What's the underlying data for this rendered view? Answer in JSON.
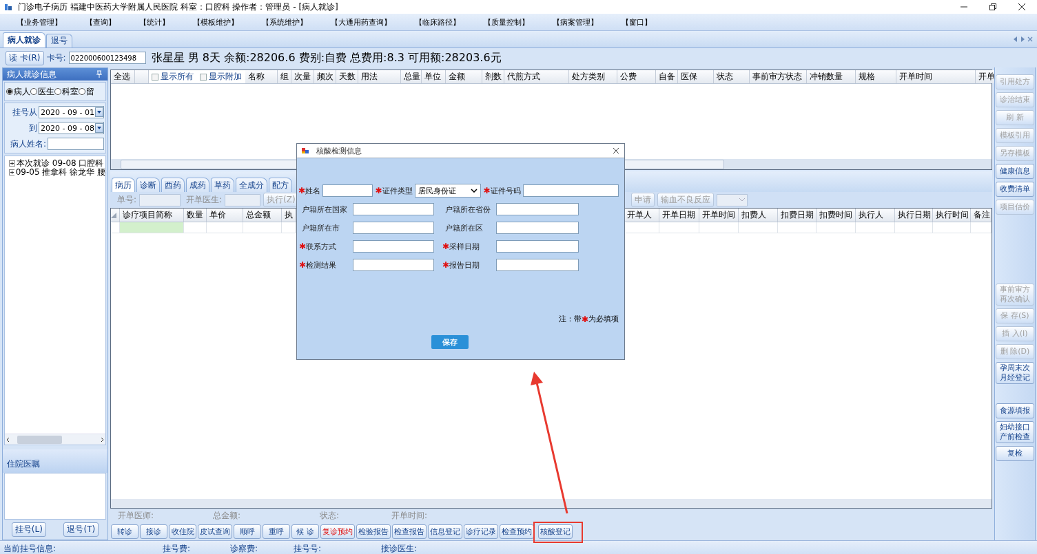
{
  "window": {
    "title": "门诊电子病历  福建中医药大学附属人民医院  科室：口腔科  操作者：管理员 - [病人就诊]"
  },
  "menu": [
    "【业务管理】",
    "【查询】",
    "【统计】",
    "【模板维护】",
    "【系统维护】",
    "【大通用药查询】",
    "【临床路径】",
    "【质量控制】",
    "【病案管理】",
    "【窗口】"
  ],
  "tabs": [
    {
      "label": "病人就诊",
      "selected": true
    },
    {
      "label": "退号",
      "selected": false
    }
  ],
  "patient_bar": {
    "read_card_button": "读 卡(R)",
    "card_label": "卡号:",
    "card_value": "022000600123498",
    "summary": "张星星 男 8天 余额:28206.6 费别:自费 总费用:8.3 可用额:28203.6元"
  },
  "left_panel": {
    "title": "病人就诊信息",
    "radios": [
      {
        "label": "病人",
        "selected": true
      },
      {
        "label": "医生",
        "selected": false
      },
      {
        "label": "科室",
        "selected": false
      },
      {
        "label": "留",
        "selected": false
      }
    ],
    "date_from": {
      "label": "挂号从",
      "value": "2020 - 09 - 01"
    },
    "date_to": {
      "label": "到",
      "value": "2020 - 09 - 08"
    },
    "name_field": {
      "label": "病人姓名:"
    },
    "tree": [
      {
        "label": "本次就诊  09-08  口腔科",
        "expanded": false
      },
      {
        "label": "09-05  推拿科  徐龙华  腰",
        "expanded": false
      }
    ],
    "section_title": "住院医嘱",
    "buttons": [
      "挂号(L)",
      "退号(T)"
    ]
  },
  "top_table": {
    "columns": [
      {
        "kind": "text",
        "label": "全选"
      },
      {
        "kind": "blank"
      },
      {
        "kind": "checkbox",
        "label": "显示所有",
        "checked": false
      },
      {
        "kind": "checkbox",
        "label": "显示附加",
        "checked": false
      },
      {
        "kind": "text",
        "label": "名称"
      },
      {
        "kind": "text",
        "label": "组"
      },
      {
        "kind": "text",
        "label": "次量"
      },
      {
        "kind": "text",
        "label": "频次"
      },
      {
        "kind": "text",
        "label": "天数"
      },
      {
        "kind": "text",
        "label": "用法"
      },
      {
        "kind": "text",
        "label": "总量"
      },
      {
        "kind": "text",
        "label": "单位"
      },
      {
        "kind": "text",
        "label": "金额"
      },
      {
        "kind": "text",
        "label": "剂数"
      },
      {
        "kind": "text",
        "label": "代煎方式"
      },
      {
        "kind": "text",
        "label": "处方类别"
      },
      {
        "kind": "text",
        "label": "公费"
      },
      {
        "kind": "text",
        "label": "自备"
      },
      {
        "kind": "text",
        "label": "医保"
      },
      {
        "kind": "text",
        "label": "状态"
      },
      {
        "kind": "text",
        "label": "事前审方状态"
      },
      {
        "kind": "text",
        "label": "冲销数量"
      },
      {
        "kind": "text",
        "label": "规格"
      },
      {
        "kind": "text",
        "label": "开单时间"
      },
      {
        "kind": "text",
        "label": "开单"
      }
    ]
  },
  "middle_tabs": [
    {
      "label": "病历",
      "selected": true
    },
    {
      "label": "诊断",
      "selected": false
    },
    {
      "label": "西药",
      "selected": false
    },
    {
      "label": "成药",
      "selected": false
    },
    {
      "label": "草药",
      "selected": false
    },
    {
      "label": "全成分",
      "selected": false
    },
    {
      "label": "配方",
      "selected": false
    }
  ],
  "order_toolbar": {
    "order_no_label": "单号:",
    "doctor_label": "开单医生:",
    "execute_button": "执行(Z)",
    "apply_button": "申请",
    "reaction_button": "输血不良反应"
  },
  "lower_table": {
    "columns": [
      {
        "kind": "selector"
      },
      {
        "kind": "text",
        "label": "诊疗项目简称"
      },
      {
        "kind": "text",
        "label": "数量"
      },
      {
        "kind": "text",
        "label": "单价"
      },
      {
        "kind": "text",
        "label": "总金额"
      },
      {
        "kind": "text",
        "label": "执"
      },
      {
        "kind": "hidden"
      },
      {
        "kind": "text",
        "label": "开单人"
      },
      {
        "kind": "text",
        "label": "开单日期"
      },
      {
        "kind": "text",
        "label": "开单时间"
      },
      {
        "kind": "text",
        "label": "扣费人"
      },
      {
        "kind": "text",
        "label": "扣费日期"
      },
      {
        "kind": "text",
        "label": "扣费时间"
      },
      {
        "kind": "text",
        "label": "执行人"
      },
      {
        "kind": "text",
        "label": "执行日期"
      },
      {
        "kind": "text",
        "label": "执行时间"
      },
      {
        "kind": "text",
        "label": "备注"
      }
    ],
    "rows": [
      {
        "selected": true
      }
    ]
  },
  "footer_info": [
    "开单医师:",
    "总金额:",
    "状态:",
    "开单时间:"
  ],
  "action_buttons": [
    {
      "label": "转诊",
      "kind": "normal"
    },
    {
      "label": "接诊",
      "kind": "normal"
    },
    {
      "label": "收住院",
      "kind": "normal"
    },
    {
      "label": "皮试查询",
      "kind": "normal"
    },
    {
      "label": "顺呼",
      "kind": "normal"
    },
    {
      "label": "重呼",
      "kind": "normal"
    },
    {
      "label": "候 诊",
      "kind": "normal"
    },
    {
      "label": "复诊预约",
      "kind": "alert"
    },
    {
      "label": "检验报告",
      "kind": "normal"
    },
    {
      "label": "检查报告",
      "kind": "normal"
    },
    {
      "label": "信息登记",
      "kind": "normal"
    },
    {
      "label": "诊疗记录",
      "kind": "normal"
    },
    {
      "label": "检查预约",
      "kind": "normal"
    },
    {
      "label": "核酸登记",
      "kind": "normal"
    }
  ],
  "right_panel": {
    "groups": [
      {
        "buttons": [
          {
            "label": "引用处方",
            "disabled": true
          },
          {
            "label": "诊治结束",
            "disabled": true
          },
          {
            "label": "刷 新",
            "disabled": true
          },
          {
            "label": "模板引用",
            "disabled": true
          },
          {
            "label": "另存模板",
            "disabled": true
          },
          {
            "label": "健康信息",
            "disabled": false
          },
          {
            "label": "收费清单",
            "disabled": false
          },
          {
            "label": "项目估价",
            "disabled": true
          }
        ]
      },
      {
        "buttons": [
          {
            "label": "事前审方再次确认",
            "disabled": true
          },
          {
            "label": "保 存(S)",
            "disabled": true
          },
          {
            "label": "插 入(I)",
            "disabled": true
          },
          {
            "label": "删 除(D)",
            "disabled": true
          },
          {
            "label": "孕周末次月经登记",
            "disabled": false
          }
        ]
      },
      {
        "buttons": [
          {
            "label": "食源填报",
            "disabled": false
          },
          {
            "label": "妇幼接口产前检查",
            "disabled": false
          },
          {
            "label": "复检",
            "disabled": false
          }
        ]
      }
    ]
  },
  "status_bar": [
    "当前挂号信息:",
    "挂号费:",
    "诊察费:",
    "挂号号:",
    "接诊医生:"
  ],
  "dialog": {
    "title": "核酸检测信息",
    "rows": [
      [
        {
          "label": "姓名",
          "required": true,
          "kind": "input"
        },
        {
          "label": "证件类型",
          "required": true,
          "kind": "select",
          "value": "居民身份证"
        },
        {
          "label": "证件号码",
          "required": true,
          "kind": "input"
        }
      ],
      [
        {
          "label": "户籍所在国家",
          "required": false,
          "kind": "input"
        },
        {
          "label": "户籍所在省份",
          "required": false,
          "kind": "input"
        }
      ],
      [
        {
          "label": "户籍所在市",
          "required": false,
          "kind": "input"
        },
        {
          "label": "户籍所在区",
          "required": false,
          "kind": "input"
        }
      ],
      [
        {
          "label": "联系方式",
          "required": true,
          "kind": "input"
        },
        {
          "label": "采样日期",
          "required": true,
          "kind": "input"
        }
      ],
      [
        {
          "label": "检测结果",
          "required": true,
          "kind": "input"
        },
        {
          "label": "报告日期",
          "required": true,
          "kind": "input"
        }
      ]
    ],
    "required_mark": "✱",
    "note": {
      "before": "注：带",
      "mark": "✱",
      "after": "为必填项"
    },
    "save_button": "保存"
  },
  "annotations": {
    "highlight_box": true,
    "arrow": true
  }
}
